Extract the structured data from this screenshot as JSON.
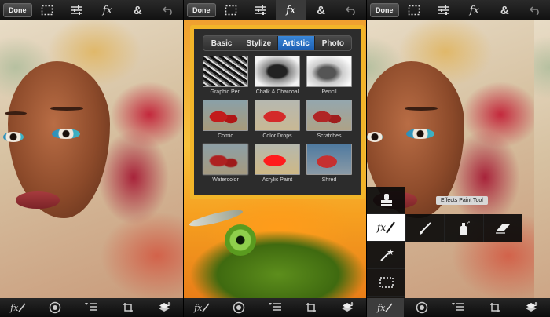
{
  "panels": [
    {
      "topbar": {
        "done_label": "Done",
        "icons": [
          "select-icon",
          "adjust-icon",
          "fx-icon",
          "ampersand-icon",
          "undo-icon"
        ],
        "fx_label": "fx",
        "amp_label": "&"
      },
      "bottombar": {
        "icons": [
          "effects-paint-icon",
          "circle-icon",
          "layers-list-icon",
          "crop-icon",
          "add-layer-icon"
        ],
        "fx_label": "fx"
      }
    },
    {
      "topbar": {
        "done_label": "Done",
        "fx_label": "fx",
        "amp_label": "&",
        "active": "fx-icon"
      },
      "filter_dialog": {
        "tabs": [
          "Basic",
          "Stylize",
          "Artistic",
          "Photo"
        ],
        "selected_tab": "Artistic",
        "filters": [
          {
            "label": "Graphic Pen"
          },
          {
            "label": "Chalk & Charcoal"
          },
          {
            "label": "Pencil"
          },
          {
            "label": "Comic"
          },
          {
            "label": "Color Drops"
          },
          {
            "label": "Scratches"
          },
          {
            "label": "Watercolor"
          },
          {
            "label": "Acrylic Paint"
          },
          {
            "label": "Shred"
          }
        ]
      },
      "bottombar": {
        "fx_label": "fx"
      }
    },
    {
      "topbar": {
        "done_label": "Done",
        "fx_label": "fx",
        "amp_label": "&"
      },
      "tool_panel": {
        "tooltip": "Effects Paint Tool",
        "tools_column": [
          "stamp-tool-icon",
          "effects-paint-tool-icon",
          "magic-wand-icon",
          "marquee-select-icon"
        ],
        "tools_row": [
          "brush-icon",
          "spray-icon",
          "eraser-icon"
        ],
        "fx_label": "fx"
      },
      "bottombar": {
        "fx_label": "fx",
        "active": "effects-paint-icon"
      }
    }
  ],
  "colors": {
    "accent_orange": "#f2b529",
    "tab_selected_blue": "#2a72c6",
    "bar_dark": "#111111"
  }
}
